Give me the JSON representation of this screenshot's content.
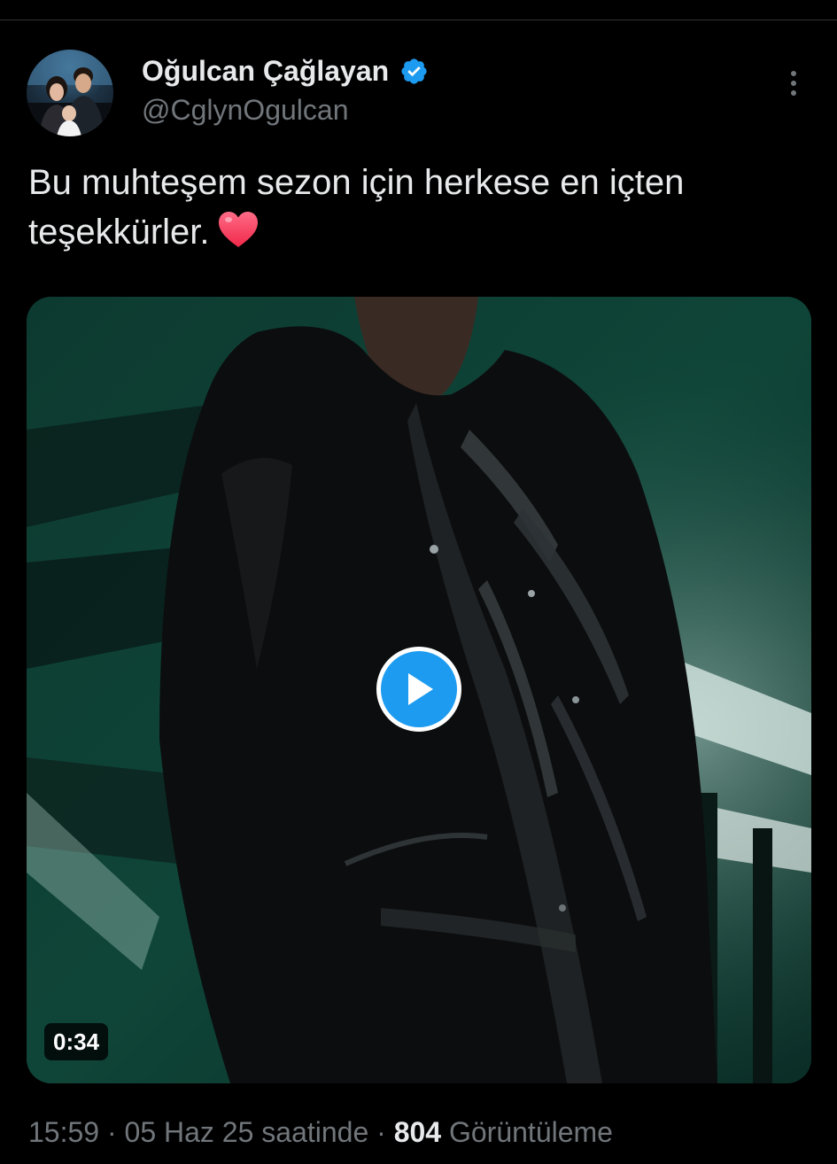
{
  "author": {
    "display_name": "Oğulcan Çağlayan",
    "handle": "@CglynOgulcan",
    "verified_icon": "verified-badge-icon",
    "avatar": "profile-photo"
  },
  "tweet": {
    "text": "Bu muhteşem sezon için herkese en içten teşekkürler.",
    "emoji": "❤️"
  },
  "media": {
    "type": "video",
    "duration": "0:34",
    "play_icon": "play-icon"
  },
  "meta": {
    "time": "15:59",
    "date": "05 Haz 25 saatinde",
    "separator": "·",
    "views_count": "804",
    "views_label": "Görüntüleme"
  },
  "colors": {
    "background": "#000000",
    "text_primary": "#e7e9ea",
    "text_secondary": "#71767b",
    "accent": "#1d9bf0",
    "divider": "#2f3336"
  }
}
